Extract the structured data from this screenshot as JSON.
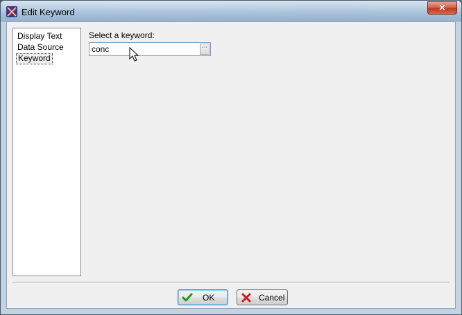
{
  "window": {
    "title": "Edit Keyword",
    "close_label": "×"
  },
  "nav": {
    "items": [
      {
        "label": "Display Text",
        "selected": false
      },
      {
        "label": "Data Source",
        "selected": false
      },
      {
        "label": "Keyword",
        "selected": true
      }
    ]
  },
  "keyword": {
    "label": "Select a keyword:",
    "value": "conc",
    "browse_label": "···"
  },
  "buttons": {
    "ok_label": "OK",
    "cancel_label": "Cancel"
  },
  "colors": {
    "ok_check": "#1a9a1a",
    "cancel_x": "#d01818",
    "close_button": "#c0391d"
  },
  "icons": {
    "app": "app-logo-icon",
    "ok": "check-icon",
    "cancel": "x-icon",
    "close": "close-icon"
  }
}
